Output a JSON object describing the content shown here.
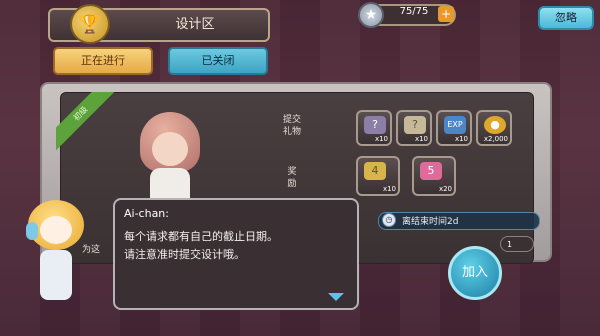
{
  "header": {
    "title": "设计区",
    "title_icon": "trophy-icon",
    "stars": "75/75",
    "plus_label": "+",
    "skip_label": "忽略"
  },
  "tabs": [
    {
      "label": "正在进行",
      "active": true
    },
    {
      "label": "已关闭",
      "active": false
    }
  ],
  "request": {
    "ribbon_label": "初级",
    "submit_label": [
      "提交",
      "礼物"
    ],
    "reward_label": [
      "奖",
      "励"
    ],
    "submit_items": [
      {
        "icon": "mystery-box-icon",
        "count": "x10"
      },
      {
        "icon": "mystery-card-icon",
        "count": "x10"
      },
      {
        "icon": "exp-icon",
        "count": "x10"
      },
      {
        "icon": "coin-icon",
        "count": "x2,000"
      }
    ],
    "reward_items": [
      {
        "icon": "ticket-4-icon",
        "count": "x10"
      },
      {
        "icon": "gift-5-icon",
        "count": "x20"
      }
    ],
    "deadline": "离结束时间2d",
    "join_count": "1",
    "join_label": "加入"
  },
  "dialog": {
    "speaker": "Ai-chan:",
    "lines": [
      "每个请求都有自己的截止日期。",
      "请注意准时提交设计哦。"
    ]
  },
  "peek_texts": [
    "为这"
  ],
  "colors": {
    "accent": "#4cb8d8",
    "tab_active": "#f7d37c",
    "ribbon": "#5ba33a"
  }
}
